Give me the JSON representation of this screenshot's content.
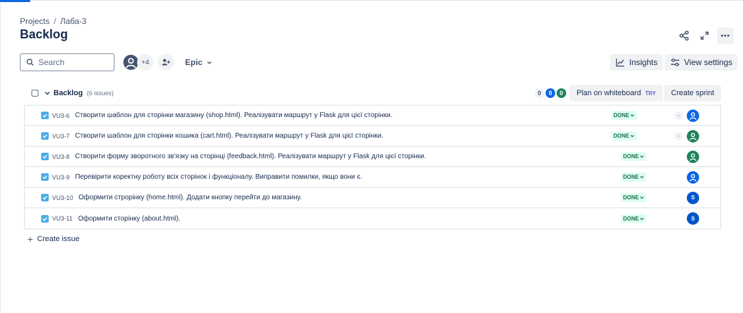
{
  "breadcrumb": {
    "projects": "Projects",
    "separator": "/",
    "project": "Лаба-3"
  },
  "page": {
    "title": "Backlog"
  },
  "toolbar": {
    "search_placeholder": "Search",
    "avatar_more_count": "+4",
    "epic_label": "Epic",
    "insights_label": "Insights",
    "view_settings_label": "View settings"
  },
  "backlog": {
    "title": "Backlog",
    "issue_count": "(6 issues)",
    "counts": {
      "todo": "0",
      "in_progress": "0",
      "done": "0"
    },
    "plan_label": "Plan on whiteboard",
    "try_label": "TRY",
    "create_sprint_label": "Create sprint"
  },
  "issues": [
    {
      "key": "VU3-6",
      "summary": "Створити шаблон для сторінки магазину (shop.html). Реалізувати маршрут у Flask для цієї сторінки.",
      "status": "DONE",
      "estimate": "-",
      "assignee_type": "blue-person",
      "assignee_letter": ""
    },
    {
      "key": "VU3-7",
      "summary": "Створити шаблон для сторінки кошика (cart.html). Реалізувати маршрут у Flask для цієї сторінки.",
      "status": "DONE",
      "estimate": "-",
      "assignee_type": "green-person",
      "assignee_letter": ""
    },
    {
      "key": "VU3-8",
      "summary": "Створити форму зворотного зв'язку на сторінці (feedback.html). Реалізувати маршрут у Flask для цієї сторінки.",
      "status": "DONE",
      "estimate": "",
      "assignee_type": "green-person",
      "assignee_letter": ""
    },
    {
      "key": "VU3-9",
      "summary": "Перевірити коректну роботу всіх сторінок і функціоналу. Виправити помилки, якщо вони є.",
      "status": "DONE",
      "estimate": "",
      "assignee_type": "blue-person",
      "assignee_letter": ""
    },
    {
      "key": "VU3-10",
      "summary": "Оформити строрінку (home.html). Додати кнопку перейти до магазину.",
      "status": "DONE",
      "estimate": "",
      "assignee_type": "letter",
      "assignee_letter": "S"
    },
    {
      "key": "VU3-11",
      "summary": "Оформити сторінку (about.html).",
      "status": "DONE",
      "estimate": "",
      "assignee_type": "letter",
      "assignee_letter": "S"
    }
  ],
  "create_issue_label": "Create issue",
  "colors": {
    "accent": "#0c66e4",
    "done_bg": "#dcfff1",
    "done_text": "#216e4e",
    "task_icon": "#4bade8"
  }
}
